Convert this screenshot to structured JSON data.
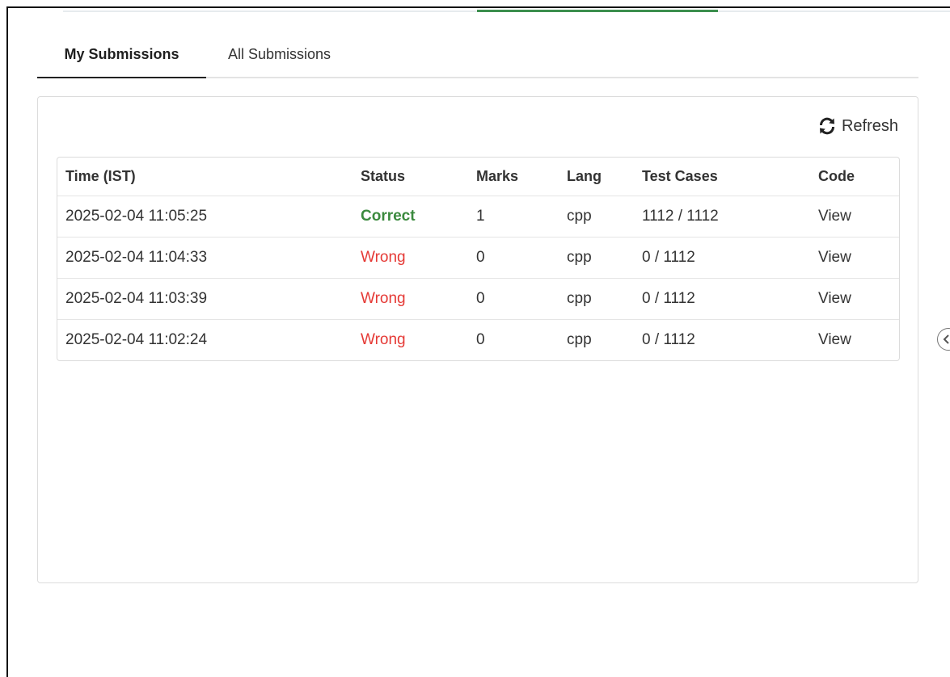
{
  "tabs": [
    {
      "label": "My Submissions",
      "active": true
    },
    {
      "label": "All Submissions",
      "active": false
    }
  ],
  "toolbar": {
    "refresh_label": "Refresh",
    "refresh_icon": "refresh-icon"
  },
  "table": {
    "columns": [
      "Time (IST)",
      "Status",
      "Marks",
      "Lang",
      "Test Cases",
      "Code"
    ],
    "rows": [
      {
        "time": "2025-02-04 11:05:25",
        "status": "Correct",
        "marks": "1",
        "lang": "cpp",
        "test_cases": "1112 / 1112",
        "code": "View"
      },
      {
        "time": "2025-02-04 11:04:33",
        "status": "Wrong",
        "marks": "0",
        "lang": "cpp",
        "test_cases": "0 / 1112",
        "code": "View"
      },
      {
        "time": "2025-02-04 11:03:39",
        "status": "Wrong",
        "marks": "0",
        "lang": "cpp",
        "test_cases": "0 / 1112",
        "code": "View"
      },
      {
        "time": "2025-02-04 11:02:24",
        "status": "Wrong",
        "marks": "0",
        "lang": "cpp",
        "test_cases": "0 / 1112",
        "code": "View"
      }
    ]
  },
  "colors": {
    "correct": "#3b8a3e",
    "wrong": "#e53935",
    "accent": "#3c8f4e"
  }
}
